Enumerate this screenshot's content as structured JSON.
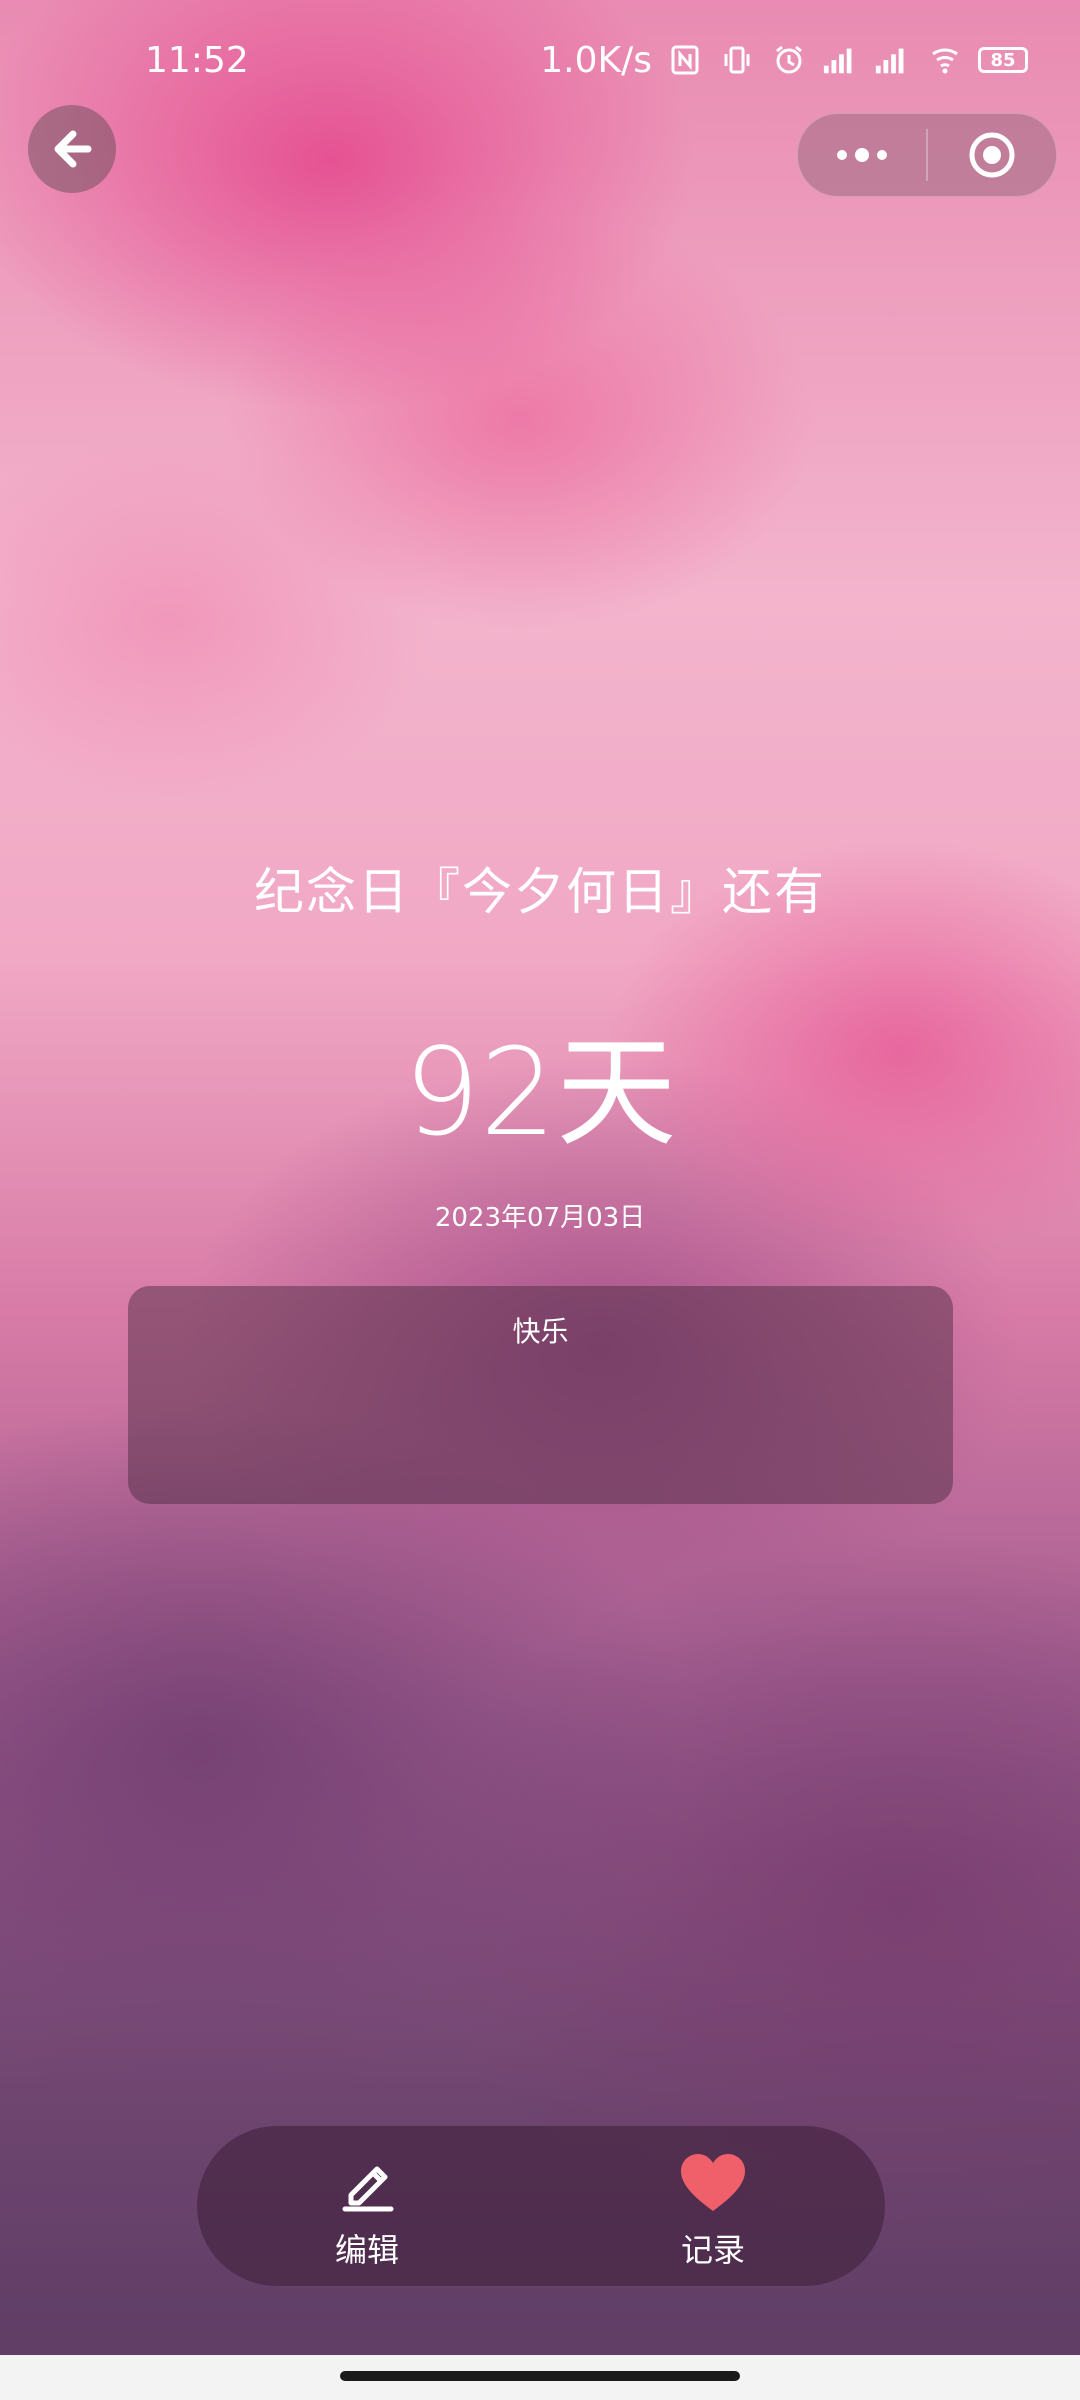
{
  "status_bar": {
    "time": "11:52",
    "net_speed": "1.0K/s",
    "battery": "85"
  },
  "event": {
    "title": "纪念日『今夕何日』还有",
    "days": "92天",
    "date": "2023年07月03日",
    "note": "快乐"
  },
  "bottom_bar": {
    "edit_label": "编辑",
    "record_label": "记录"
  },
  "colors": {
    "heart": "#f0606a"
  }
}
